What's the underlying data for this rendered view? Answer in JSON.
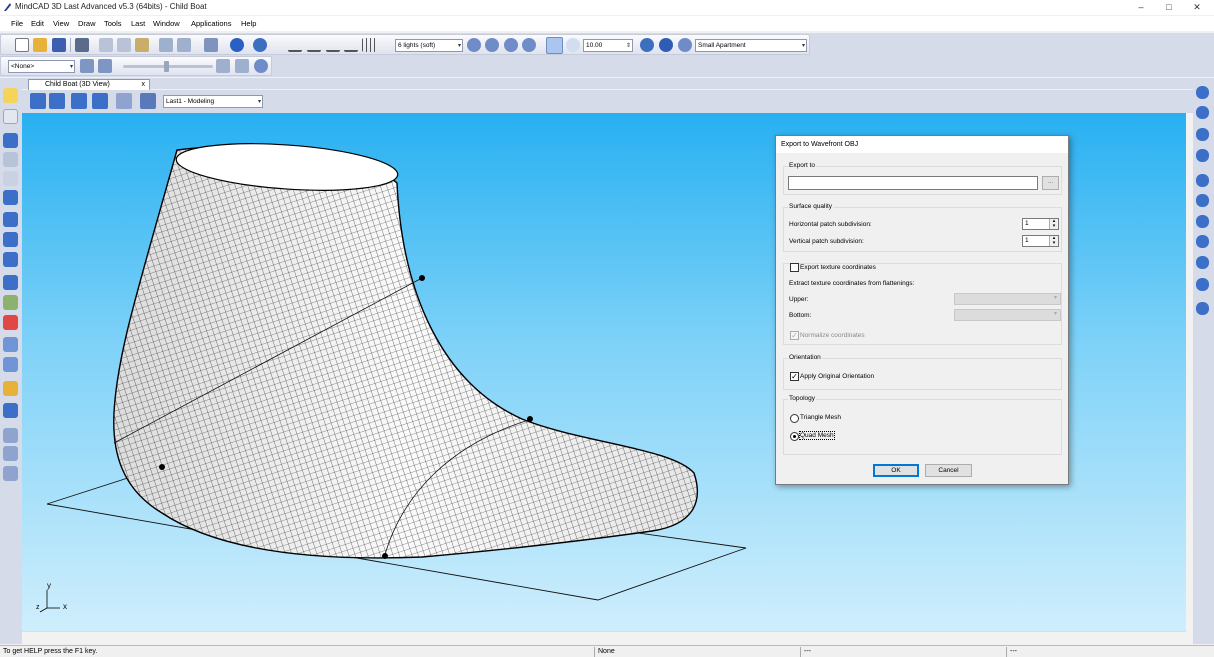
{
  "window": {
    "title": "MindCAD 3D Last Advanced v5.3 (64bits) - Child Boat",
    "minimize": "–",
    "maximize": "□",
    "close": "✕"
  },
  "menu": [
    "File",
    "Edit",
    "View",
    "Draw",
    "Tools",
    "Last",
    "Window",
    "Applications",
    "Help"
  ],
  "toolbar": {
    "lighting_select": "6 lights (soft)",
    "zoom_value": "10.00",
    "environment_select": "Small Apartment",
    "layer_select": "<None>"
  },
  "document_tab": {
    "label": "Child Boat (3D View)",
    "close": "x"
  },
  "view_toolbar": {
    "mode_select": "Last1 - Modeling"
  },
  "axes": {
    "y": "y",
    "x": "x",
    "z": "z"
  },
  "dialog": {
    "title": "Export to Wavefront OBJ",
    "export_to": {
      "label": "Export to",
      "value": "",
      "browse": "..."
    },
    "surface_quality": {
      "label": "Surface quality",
      "horizontal_label": "Horizontal patch subdivision:",
      "horizontal_value": "1",
      "vertical_label": "Vertical patch subdivision:",
      "vertical_value": "1"
    },
    "texture": {
      "export_label": "Export texture coordinates",
      "export_checked": false,
      "extract_label": "Extract texture coordinates from flattenings:",
      "upper_label": "Upper:",
      "bottom_label": "Bottom:",
      "normalize_label": "Normalize coordinates",
      "normalize_checked": true
    },
    "orientation": {
      "label": "Orientation",
      "apply_label": "Apply Original Orientation",
      "apply_checked": true
    },
    "topology": {
      "label": "Topology",
      "triangle_label": "Triangle Mesh",
      "quad_label": "Quad Mesh",
      "selected": "Quad Mesh"
    },
    "ok": "OK",
    "cancel": "Cancel"
  },
  "status": {
    "help": "To get HELP press the F1 key.",
    "selection": "None",
    "pane2": "---",
    "pane3": "---"
  },
  "colors": {
    "highlight": "#ffef00",
    "viewport_top": "#28b0f1",
    "viewport_bottom": "#cfeefc",
    "chrome": "#d6dbe9"
  }
}
